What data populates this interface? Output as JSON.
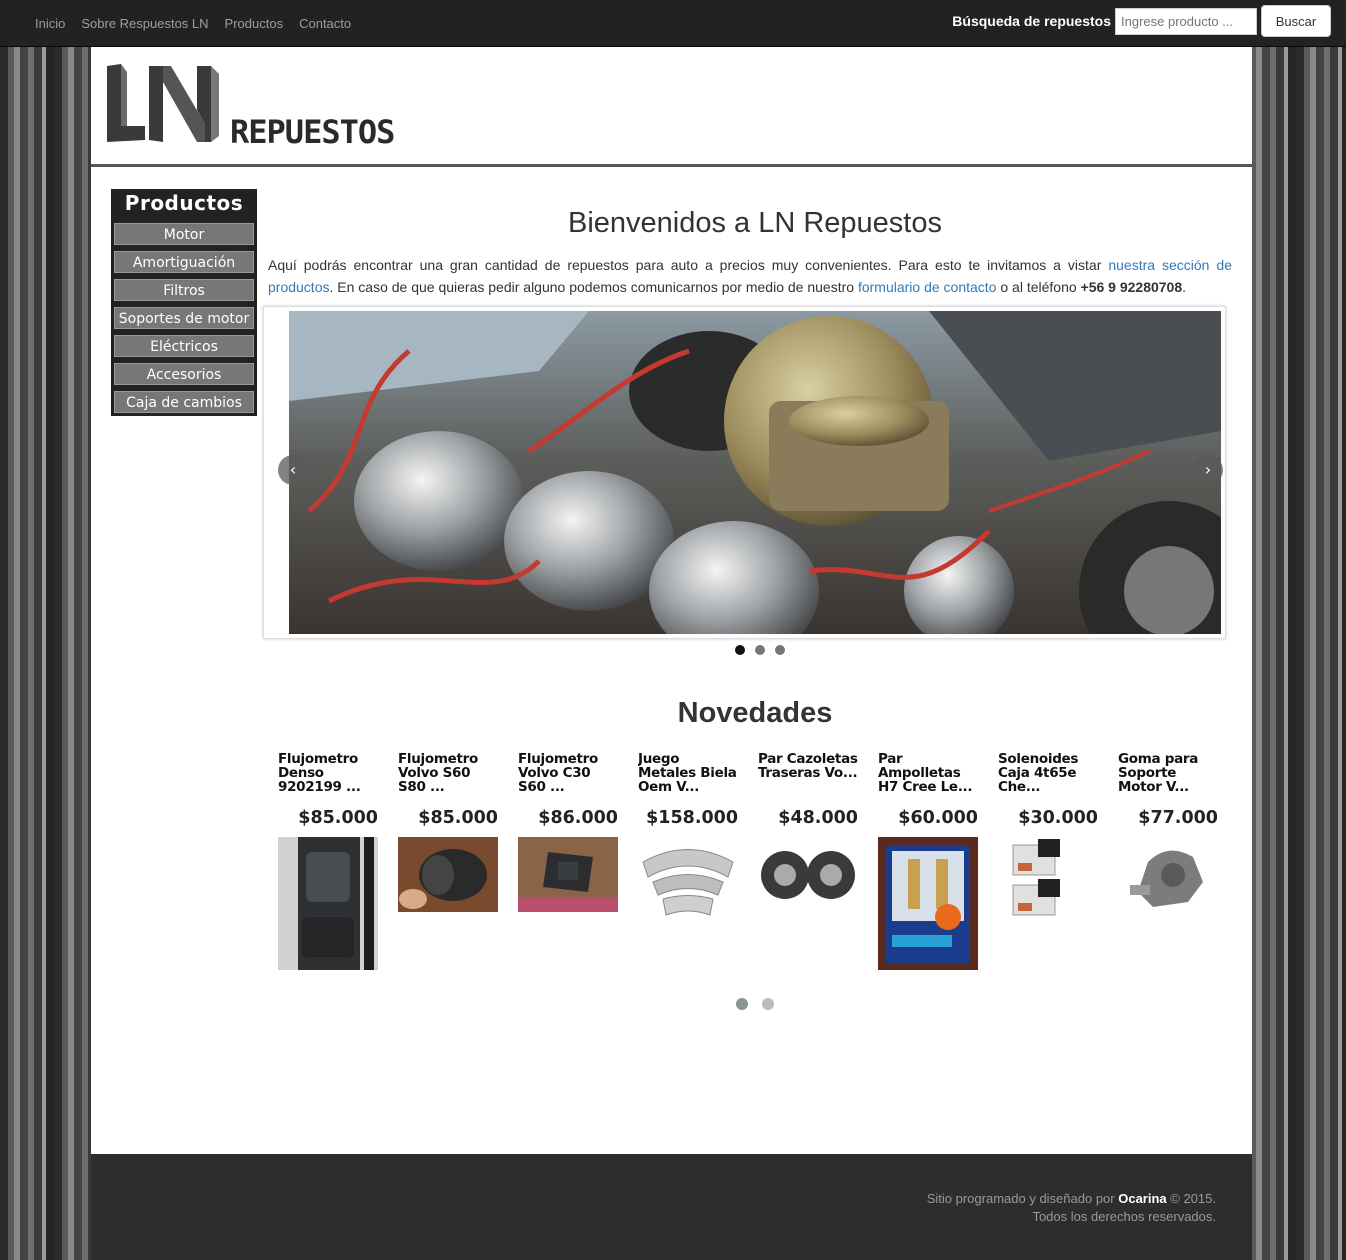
{
  "nav": {
    "links": [
      "Inicio",
      "Sobre Respuestos LN",
      "Productos",
      "Contacto"
    ],
    "search_label": "Búsqueda de repuestos",
    "search_placeholder": "Ingrese producto ...",
    "search_button": "Buscar"
  },
  "logo": {
    "mark": "LN",
    "word": "REPUESTOS"
  },
  "sidebar": {
    "title": "Productos",
    "items": [
      "Motor",
      "Amortiguación",
      "Filtros",
      "Soportes de motor",
      "Eléctricos",
      "Accesorios",
      "Caja de cambios"
    ]
  },
  "welcome": {
    "title": "Bienvenidos a LN Repuestos",
    "text1": "Aquí podrás encontrar una gran cantidad de repuestos para auto a precios muy convenientes. Para esto te invitamos a vistar ",
    "link1": "nuestra sección de productos",
    "text2": ". En caso de que quieras pedir alguno podemos comunicarnos por medio de nuestro ",
    "link2": "formulario de contacto",
    "text3": " o al teléfono ",
    "phone": "+56 9 92280708",
    "text4": "."
  },
  "carousel": {
    "prev": "‹",
    "next": "›",
    "slides": 3,
    "active": 0
  },
  "novedades": {
    "title": "Novedades",
    "products": [
      {
        "name": "Flujometro Denso 9202199 ...",
        "price": "$85.000"
      },
      {
        "name": "Flujometro Volvo S60 S80 ...",
        "price": "$85.000"
      },
      {
        "name": "Flujometro Volvo C30 S60 ...",
        "price": "$86.000"
      },
      {
        "name": "Juego Metales Biela Oem V...",
        "price": "$158.000"
      },
      {
        "name": "Par Cazoletas Traseras Vo...",
        "price": "$48.000"
      },
      {
        "name": "Par Ampolletas H7 Cree Le...",
        "price": "$60.000"
      },
      {
        "name": "Solenoides Caja 4t65e Che...",
        "price": "$30.000"
      },
      {
        "name": "Goma para Soporte Motor V...",
        "price": "$77.000"
      }
    ],
    "pages": 2,
    "active_page": 0
  },
  "footer": {
    "line1_a": "Sitio programado y diseñado por ",
    "brand": "Ocarina",
    "line1_b": " © 2015.",
    "line2": "Todos los derechos reservados."
  },
  "colors": {
    "navbar": "#222222",
    "link": "#337ab7",
    "footer": "#2d2d2d",
    "sidebar_item": "#777777"
  }
}
